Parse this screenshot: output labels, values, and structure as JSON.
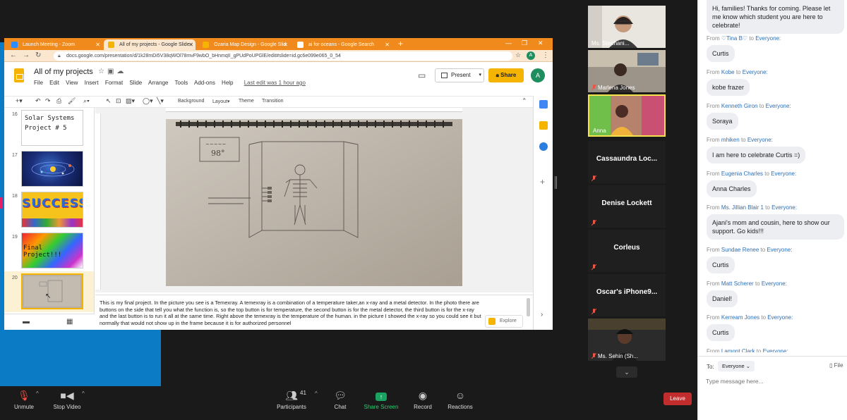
{
  "browser": {
    "tabs": [
      {
        "title": "Launch Meeting - Zoom",
        "color": "#2d8cff"
      },
      {
        "title": "All of my projects - Google Slide",
        "color": "#f4b400"
      },
      {
        "title": "Ozaria Map Design - Google Slid",
        "color": "#f4b400"
      },
      {
        "title": "ai for oceans - Google Search",
        "color": "#4285f4"
      }
    ],
    "url": "docs.google.com/presentation/d/1k28mDi5V38qWOl78mvF9wbO_bHnmqII_gPUdPoUPGlE/edit#slide=id.gc6e099e065_0_54",
    "user_initial": "A"
  },
  "slides": {
    "title": "All of my projects",
    "menu": [
      "File",
      "Edit",
      "View",
      "Insert",
      "Format",
      "Slide",
      "Arrange",
      "Tools",
      "Add-ons",
      "Help"
    ],
    "last_edit": "Last edit was 1 hour ago",
    "present_label": "Present",
    "share_label": "Share",
    "toolbar": {
      "background": "Background",
      "layout": "Layout",
      "theme": "Theme",
      "transition": "Transition"
    },
    "thumbnails": [
      {
        "num": "16",
        "text": "Solar Systems Project # 5"
      },
      {
        "num": "17",
        "text": ""
      },
      {
        "num": "18",
        "text": "SUCCESS"
      },
      {
        "num": "19",
        "text": "Final Project!!!"
      },
      {
        "num": "20",
        "text": ""
      }
    ],
    "notes": "This is my final project. In the picture you see is a Temexray. A temexray is a combination of a temperature taker,an x-ray and a metal detector. In the photo there are buttons on the side that tell you what the function is, so the top button is for temperature, the second button is for the metal detector, the third button is for the x-ray and the last button is to run it all at the same time. Right above the temexray is the temperature of the human. in the picture I showed the x-ray so you could see it but normally that would not show up in the frame because it is for authorized personnel",
    "explore_label": "Explore"
  },
  "gallery": [
    {
      "name": "Ms. Stephani...",
      "type": "video",
      "muted": false,
      "active": false
    },
    {
      "name": "Marlena Jones",
      "type": "video",
      "muted": true,
      "active": false
    },
    {
      "name": "Anna",
      "type": "video",
      "muted": false,
      "active": true
    },
    {
      "name": "Cassaundra Loc...",
      "type": "text",
      "muted": true,
      "active": false
    },
    {
      "name": "Denise Lockett",
      "type": "text",
      "muted": true,
      "active": false
    },
    {
      "name": "Corleus",
      "type": "text",
      "muted": true,
      "active": false
    },
    {
      "name": "Oscar's iPhone9...",
      "type": "text",
      "muted": true,
      "active": false
    },
    {
      "name": "Ms. Sehin (Sh...",
      "type": "video",
      "muted": true,
      "active": false
    }
  ],
  "chat": {
    "first_message": "Hi, families! Thanks for coming. Please let me know which student you are here to celebrate!",
    "messages": [
      {
        "from": "♡Tina B♡",
        "to": "Everyone",
        "text": "Curtis"
      },
      {
        "from": "Kobe",
        "to": "Everyone",
        "text": "kobe frazer"
      },
      {
        "from": "Kenneth Giron",
        "to": "Everyone",
        "text": "Soraya"
      },
      {
        "from": "mhiken",
        "to": "Everyone",
        "text": "I am here to celebrate Curtis =)"
      },
      {
        "from": "Eugenia Charles",
        "to": "Everyone",
        "text": "Anna Charles"
      },
      {
        "from": "Ms. Jillian Blair 1",
        "to": "Everyone",
        "text": "Ajani's mom and cousin, here to show our support.  Go kids!!!"
      },
      {
        "from": "Sundae Renee",
        "to": "Everyone",
        "text": "Curtis"
      },
      {
        "from": "Matt Scherer",
        "to": "Everyone",
        "text": "Daniel!"
      },
      {
        "from": "Kerream Jones",
        "to": "Everyone",
        "text": "Curtis"
      },
      {
        "from": "Lamont Clark",
        "to": "Everyone",
        "text": ""
      }
    ],
    "from_word": "From",
    "to_word": "to",
    "to_label": "To:",
    "to_value": "Everyone",
    "file_label": "File",
    "input_placeholder": "Type message here..."
  },
  "zoom_toolbar": {
    "unmute": "Unmute",
    "stop_video": "Stop Video",
    "participants": "Participants",
    "participant_count": "41",
    "chat": "Chat",
    "share_screen": "Share Screen",
    "record": "Record",
    "reactions": "Reactions",
    "leave": "Leave"
  }
}
